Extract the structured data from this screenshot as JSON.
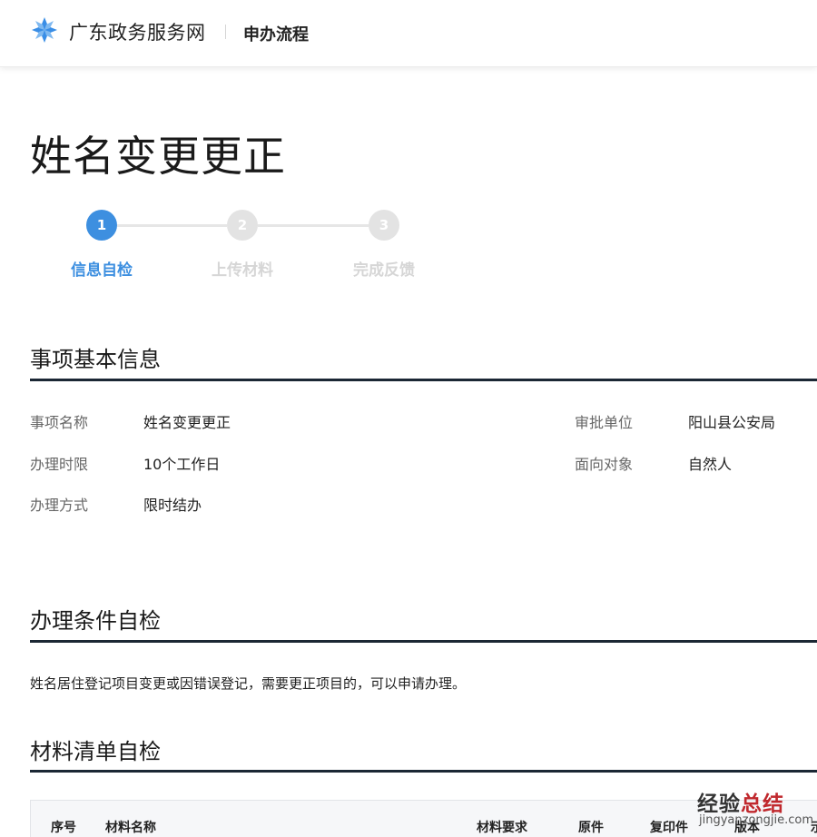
{
  "header": {
    "site_name": "广东政务服务网",
    "sub_title": "申办流程",
    "logo_color": "#3a8ee6"
  },
  "page_title": "姓名变更更正",
  "steps": [
    {
      "number": "1",
      "label": "信息自检",
      "state": "active"
    },
    {
      "number": "2",
      "label": "上传材料",
      "state": "inactive"
    },
    {
      "number": "3",
      "label": "完成反馈",
      "state": "inactive"
    }
  ],
  "colors": {
    "active": "#3d8fe0",
    "inactive_circle": "#e3e3e3",
    "inactive_label": "#d6d6d6",
    "section_rule": "#1b2734"
  },
  "basic_info": {
    "title": "事项基本信息",
    "fields": [
      {
        "label": "事项名称",
        "value": "姓名变更更正"
      },
      {
        "label": "审批单位",
        "value": "阳山县公安局"
      },
      {
        "label": "办理时限",
        "value": "10个工作日"
      },
      {
        "label": "面向对象",
        "value": "自然人"
      },
      {
        "label": "办理方式",
        "value": "限时结办"
      }
    ]
  },
  "conditions": {
    "title": "办理条件自检",
    "text": "姓名居住登记项目变更或因错误登记，需要更正项目的，可以申请办理。"
  },
  "materials": {
    "title": "材料清单自检",
    "columns": [
      "序号",
      "材料名称",
      "材料要求",
      "原件",
      "复印件",
      "版本",
      "示"
    ]
  },
  "watermark": {
    "cn_a": "经验",
    "cn_b": "总结",
    "en": "jingyanzongjie.com"
  }
}
